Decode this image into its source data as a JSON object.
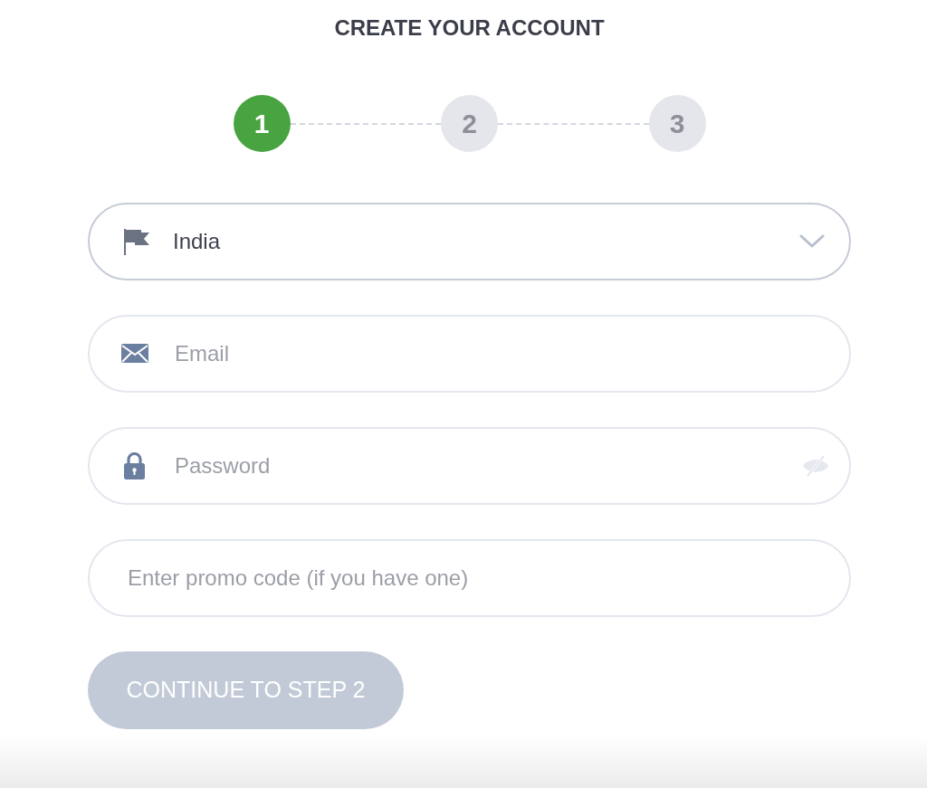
{
  "title": "CREATE YOUR ACCOUNT",
  "steps": [
    {
      "label": "1",
      "selected": true
    },
    {
      "label": "2",
      "selected": false
    },
    {
      "label": "3",
      "selected": false
    }
  ],
  "fields": [
    {
      "kind": "select",
      "value": "India"
    },
    {
      "kind": "email",
      "placeholder": "Email"
    },
    {
      "kind": "password",
      "placeholder": "Password"
    },
    {
      "kind": "text",
      "placeholder": "Enter promo code (if you have one)"
    }
  ],
  "button": {
    "label": "CONTINUE TO STEP 2",
    "disabled": true
  }
}
